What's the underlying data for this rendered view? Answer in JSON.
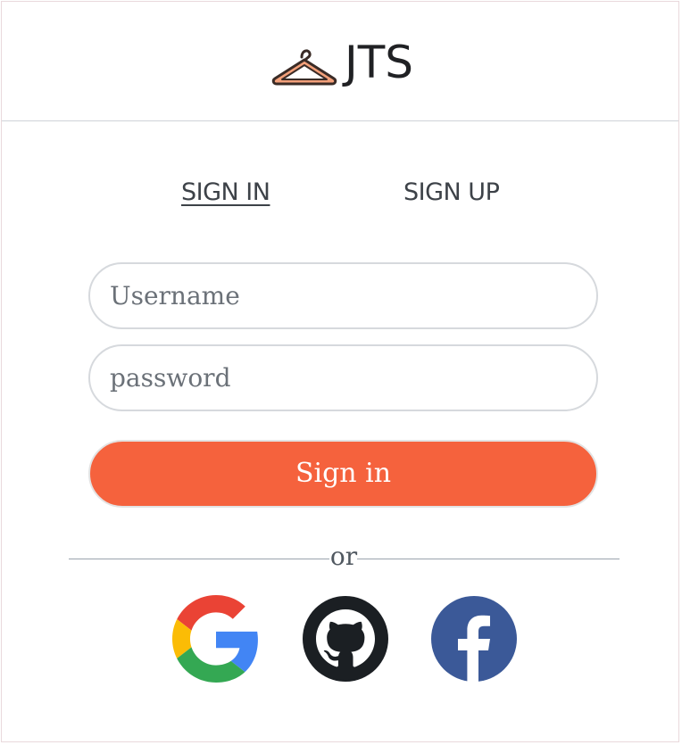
{
  "header": {
    "brand": "JTS",
    "logo_icon": "clothes-hanger-icon",
    "logo_colors": {
      "body": "#f3a07a",
      "outline": "#3a2b26"
    }
  },
  "tabs": [
    {
      "label": "SIGN IN",
      "active": true
    },
    {
      "label": "SIGN UP",
      "active": false
    }
  ],
  "form": {
    "username_placeholder": "Username",
    "password_placeholder": "password",
    "submit_label": "Sign in",
    "submit_color": "#f5623d"
  },
  "divider": {
    "text": "or"
  },
  "social": [
    {
      "icon": "google-icon"
    },
    {
      "icon": "github-icon",
      "color": "#1b1f23"
    },
    {
      "icon": "facebook-icon",
      "color": "#3b5998"
    }
  ]
}
